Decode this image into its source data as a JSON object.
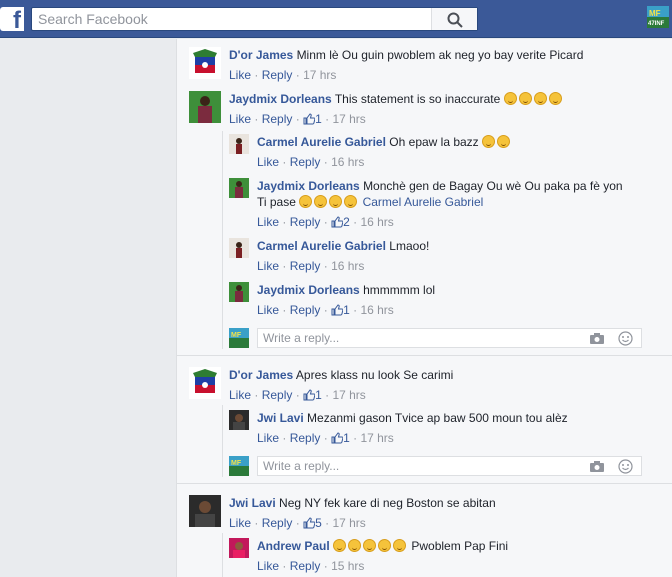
{
  "header": {
    "logo": "f",
    "search_placeholder": "Search Facebook",
    "avatar_text": "MF\n47INF"
  },
  "labels": {
    "like": "Like",
    "reply": "Reply",
    "dot": "·"
  },
  "comments": [
    {
      "author": "D'or James",
      "text": "Minm lè Ou guin pwoblem ak neg yo bay verite Picard",
      "likes": "",
      "time": "17 hrs"
    },
    {
      "author": "Jaydmix Dorleans",
      "text": "This statement is so inaccurate",
      "emoji_count": 4,
      "likes": "1",
      "time": "17 hrs"
    },
    {
      "author": "Carmel Aurelie Gabriel",
      "text": "Oh epaw la bazz",
      "emoji_count": 2,
      "likes": "",
      "time": "16 hrs"
    },
    {
      "author": "Jaydmix Dorleans",
      "text": "Monchè gen de Bagay Ou wè Ou paka pa fè yon",
      "text2": "Ti pase",
      "mention": "Carmel Aurelie Gabriel",
      "emoji_count": 4,
      "likes": "2",
      "time": "16 hrs"
    },
    {
      "author": "Carmel Aurelie Gabriel",
      "text": "Lmaoo!",
      "likes": "",
      "time": "16 hrs"
    },
    {
      "author": "Jaydmix Dorleans",
      "text": "hmmmmm lol",
      "likes": "1",
      "time": "16 hrs"
    },
    {
      "author": "D'or James",
      "text": "Apres klass nu look Se carimi",
      "likes": "1",
      "time": "17 hrs"
    },
    {
      "author": "Jwi Lavi",
      "text": "Mezanmi gason Tvice ap baw 500 moun tou alèz",
      "likes": "1",
      "time": "17 hrs"
    },
    {
      "author": "Jwi Lavi",
      "text": "Neg NY fek kare di neg Boston se abitan",
      "likes": "5",
      "time": "17 hrs"
    },
    {
      "author": "Andrew Paul",
      "text": "Pwoblem Pap Fini",
      "emoji_count": 5,
      "likes": "",
      "time": "15 hrs"
    }
  ],
  "reply_box": {
    "placeholder": "Write a reply..."
  },
  "colors": {
    "bar": "#3b5998",
    "link": "#365899",
    "meta": "#90949c"
  }
}
